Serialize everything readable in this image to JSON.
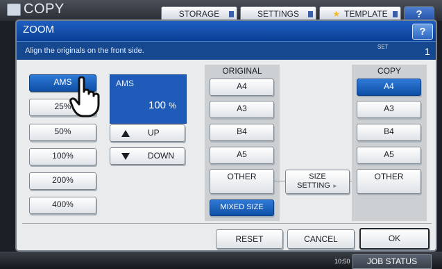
{
  "background": {
    "app_title": "COPY",
    "tabs": [
      {
        "label": "STORAGE"
      },
      {
        "label": "SETTINGS"
      },
      {
        "label": "TEMPLATE"
      }
    ],
    "help_label": "?",
    "clock": "10:50",
    "job_status_label": "JOB STATUS"
  },
  "dialog": {
    "title": "ZOOM",
    "help_label": "?",
    "message": "Align the originals on the front side.",
    "set_label": "SET",
    "set_value": "1"
  },
  "zoom_presets": [
    {
      "label": "AMS",
      "selected": true
    },
    {
      "label": "25%"
    },
    {
      "label": "50%"
    },
    {
      "label": "100%"
    },
    {
      "label": "200%"
    },
    {
      "label": "400%"
    }
  ],
  "ams_display": {
    "label": "AMS",
    "value": "100",
    "unit": "%"
  },
  "up_label": "UP",
  "down_label": "DOWN",
  "original": {
    "header": "ORIGINAL",
    "sizes": [
      {
        "label": "A4"
      },
      {
        "label": "A3"
      },
      {
        "label": "B4"
      },
      {
        "label": "A5"
      },
      {
        "label": "OTHER"
      }
    ],
    "mixed_size_label": "MIXED SIZE"
  },
  "size_setting_label_line1": "SIZE",
  "size_setting_label_line2": "SETTING",
  "copy": {
    "header": "COPY",
    "sizes": [
      {
        "label": "A4",
        "selected": true
      },
      {
        "label": "A3"
      },
      {
        "label": "B4"
      },
      {
        "label": "A5"
      },
      {
        "label": "OTHER"
      }
    ]
  },
  "footer": {
    "reset_label": "RESET",
    "cancel_label": "CANCEL",
    "ok_label": "OK"
  },
  "colors": {
    "accent": "#1f5bb8",
    "selected": "#0e4fa6",
    "panel": "#cdd0d3"
  }
}
